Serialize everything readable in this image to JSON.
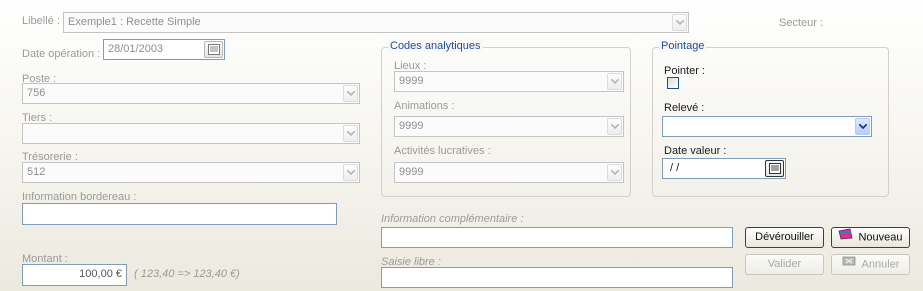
{
  "header": {
    "libelle_label": "Libellé :",
    "libelle_value": "Exemple1 : Recette Simple",
    "secteur_label": "Secteur :"
  },
  "left": {
    "date_operation_label": "Date opération :",
    "date_operation_value": "28/01/2003",
    "poste_label": "Poste :",
    "poste_value": "756",
    "tiers_label": "Tiers :",
    "tiers_value": "",
    "tresorerie_label": "Trésorerie :",
    "tresorerie_value": "512",
    "info_bordereau_label": "Information bordereau :",
    "info_bordereau_value": "",
    "montant_label": "Montant :",
    "montant_value": "100,00 €",
    "montant_hint": "( 123,40 => 123,40 €)"
  },
  "codes_analytiques": {
    "title": "Codes analytiques",
    "lieux_label": "Lieux :",
    "lieux_value": "9999",
    "animations_label": "Animations :",
    "animations_value": "9999",
    "activites_label": "Activités lucratives :",
    "activites_value": "9999"
  },
  "pointage": {
    "title": "Pointage",
    "pointer_label": "Pointer :",
    "pointer_checked": false,
    "releve_label": "Relevé :",
    "releve_value": "",
    "date_valeur_label": "Date valeur :",
    "date_valeur_value": " / /"
  },
  "bottom": {
    "info_complementaire_label": "Information complémentaire :",
    "info_complementaire_value": "",
    "saisie_libre_label": "Saisie libre :",
    "saisie_libre_value": ""
  },
  "buttons": {
    "deverouiller": "Dévérouiller",
    "nouveau": "Nouveau",
    "valider": "Valider",
    "annuler": "Annuler"
  },
  "colors": {
    "group_title": "#1f4c9a",
    "disabled_text": "#9a9a9a",
    "active_border": "#7f9db9"
  }
}
